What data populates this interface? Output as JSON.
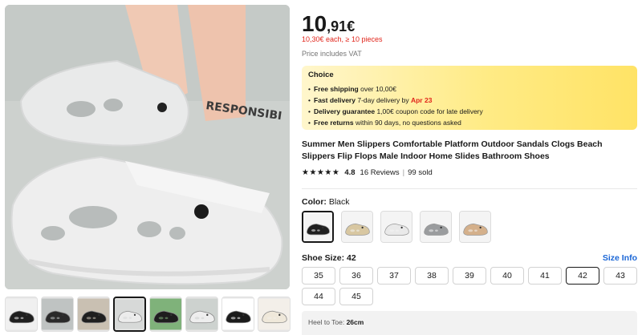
{
  "gallery": {
    "main_image": "white hollow platform clog slippers worn on feet",
    "thumbnails": [
      {
        "name": "thumb-black-clog"
      },
      {
        "name": "thumb-black-clog-side"
      },
      {
        "name": "thumb-black-clog-worn"
      },
      {
        "name": "thumb-white-clog-selected"
      },
      {
        "name": "thumb-green-background"
      },
      {
        "name": "thumb-clog-worn-feet"
      },
      {
        "name": "thumb-black-pair"
      },
      {
        "name": "thumb-beige-clog"
      }
    ],
    "active_index": 3
  },
  "price": {
    "integer": "10",
    "decimal": ",91",
    "currency": "€",
    "bulk_text": "10,30€ each, ≥ 10 pieces",
    "vat_text": "Price includes VAT"
  },
  "choice": {
    "title": "Choice",
    "rows": [
      {
        "bold": "Free shipping",
        "text": " over 10,00€",
        "highlight": ""
      },
      {
        "bold": "Fast delivery",
        "text": " 7-day delivery by ",
        "highlight": "Apr 23"
      },
      {
        "bold": "Delivery guarantee",
        "text": "  1,00€ coupon code for late delivery",
        "highlight": ""
      },
      {
        "bold": "Free returns",
        "text": "  within 90 days, no questions asked",
        "highlight": ""
      }
    ],
    "bullet": "•"
  },
  "product": {
    "title": "Summer Men Slippers Comfortable Platform Outdoor Sandals Clogs Beach Slippers Flip Flops Male Indoor Home Slides Bathroom Shoes",
    "stars": "★★★★★",
    "rating": "4.8",
    "reviews": "16 Reviews",
    "separator": "|",
    "sold": "99 sold"
  },
  "color": {
    "label": "Color:",
    "selected": "Black",
    "options": [
      {
        "name": "Black",
        "fill": "#1f1f1f"
      },
      {
        "name": "Beige",
        "fill": "#d8c7a1"
      },
      {
        "name": "White",
        "fill": "#e9e9e9"
      },
      {
        "name": "Grey",
        "fill": "#9a9c9e"
      },
      {
        "name": "Khaki",
        "fill": "#d4b08b"
      }
    ],
    "selected_index": 0
  },
  "size": {
    "label": "Shoe Size: 42",
    "info_link": "Size Info",
    "options": [
      "35",
      "36",
      "37",
      "38",
      "39",
      "40",
      "41",
      "42",
      "43",
      "44",
      "45"
    ],
    "selected_index": 7
  },
  "footer": {
    "key": "Heel to Toe: ",
    "value": "26cm"
  },
  "colors": {
    "accent_red": "#e1251b",
    "link_blue": "#1a66d6",
    "choice_yellow": "#ffe366"
  }
}
